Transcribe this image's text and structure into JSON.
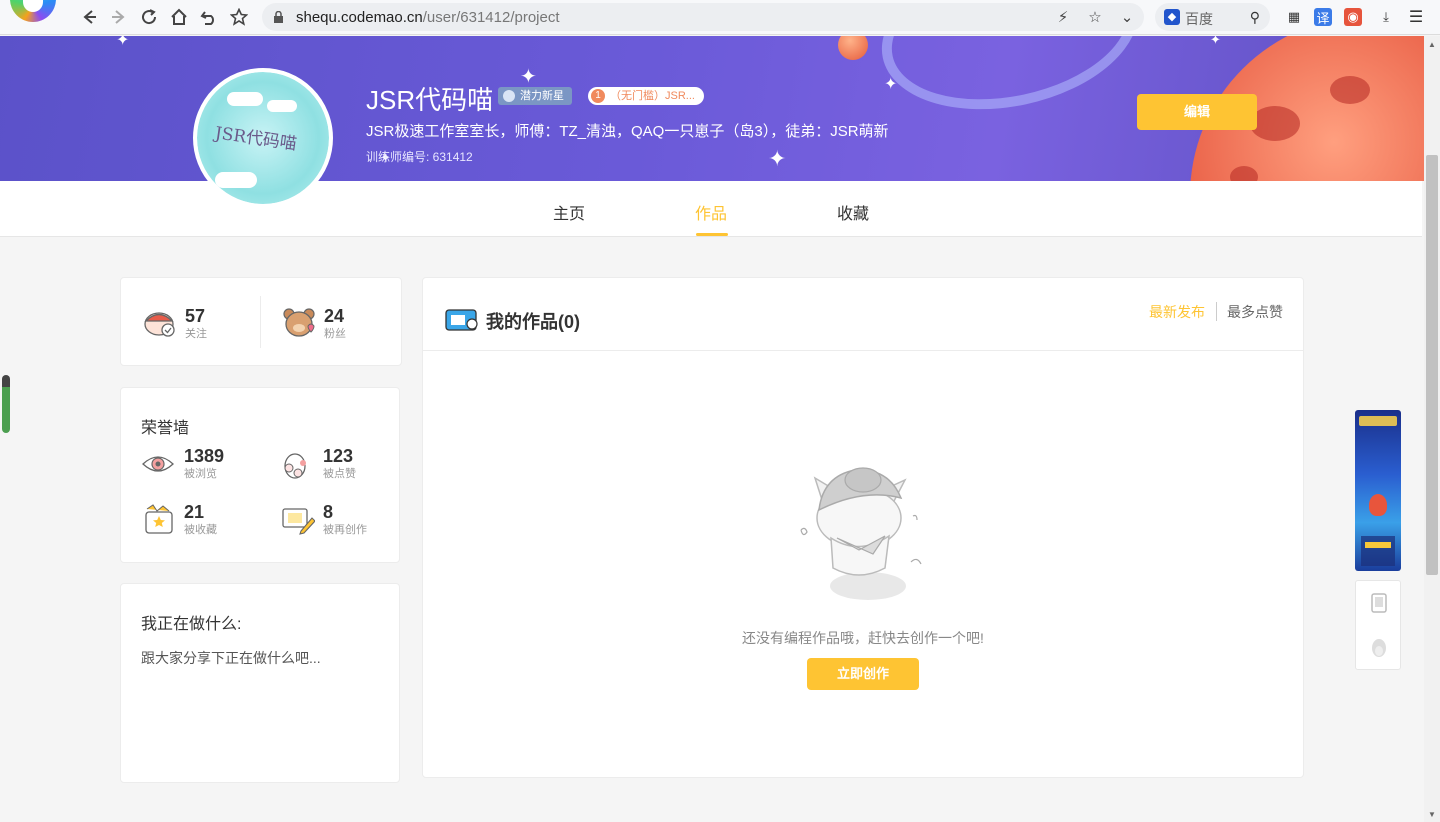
{
  "browser": {
    "url_host": "shequ.codemao.cn",
    "url_path": "/user/631412/project",
    "search_engine": "百度"
  },
  "profile": {
    "name": "JSR代码喵",
    "avatar_text": "JSR代码喵",
    "badge_star": "潜力新星",
    "badge_level_num": "1",
    "badge_level_text": "（无门槛）JSR...",
    "description": "JSR极速工作室室长，师傅：TZ_清浊，QAQ一只崽子（岛3），徒弟：JSR萌新",
    "trainer_id": "训练师编号: 631412",
    "edit_label": "编辑"
  },
  "tabs": [
    {
      "label": "主页",
      "active": false
    },
    {
      "label": "作品",
      "active": true
    },
    {
      "label": "收藏",
      "active": false
    }
  ],
  "follow_stats": {
    "following_count": "57",
    "following_label": "关注",
    "fans_count": "24",
    "fans_label": "粉丝"
  },
  "honor_wall": {
    "title": "荣誉墙",
    "views_count": "1389",
    "views_label": "被浏览",
    "likes_count": "123",
    "likes_label": "被点赞",
    "collects_count": "21",
    "collects_label": "被收藏",
    "remix_count": "8",
    "remix_label": "被再创作"
  },
  "doing": {
    "title": "我正在做什么:",
    "placeholder": "跟大家分享下正在做什么吧..."
  },
  "works": {
    "title": "我的作品(0)",
    "sort_newest": "最新发布",
    "sort_most_liked": "最多点赞",
    "empty_message": "还没有编程作品哦，赶快去创作一个吧!",
    "create_label": "立即创作"
  },
  "colors": {
    "accent": "#fec433",
    "banner": "#6a5ad8"
  }
}
